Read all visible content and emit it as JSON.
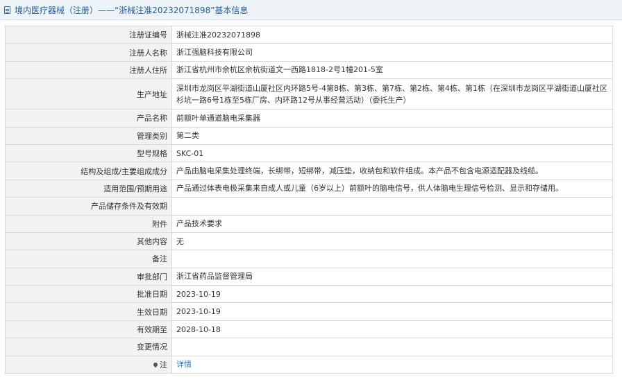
{
  "header": {
    "title": "境内医疗器械（注册）——“浙械注准20232071898”基本信息"
  },
  "rows": [
    {
      "label": "注册证编号",
      "value": "浙械注准20232071898"
    },
    {
      "label": "注册人名称",
      "value": "浙江强脑科技有限公司"
    },
    {
      "label": "注册人住所",
      "value": "浙江省杭州市余杭区余杭街道文一西路1818-2号1幢201-5室"
    },
    {
      "label": "生产地址",
      "value": "深圳市龙岗区平湖街道山厦社区内环路5号-4第8栋、第3栋、第7栋、第2栋、第4栋、第1栋（在深圳市龙岗区平湖街道山厦社区杉坑一路6号1栋至5栋厂房、内环路12号从事经营活动）（委托生产）"
    },
    {
      "label": "产品名称",
      "value": "前额叶单通道脑电采集器"
    },
    {
      "label": "管理类别",
      "value": "第二类"
    },
    {
      "label": "型号规格",
      "value": "SKC-01"
    },
    {
      "label": "结构及组成/主要组成成分",
      "value": "产品由脑电采集处理终端，长绑带，短绑带，减压垫，收纳包和软件组成。本产品不包含电源适配器及线缆。"
    },
    {
      "label": "适用范围/预期用途",
      "value": "产品通过体表电极采集来自成人或儿童（6岁以上）前额叶的脑电信号，供人体脑电生理信号检测、显示和存储用。"
    },
    {
      "label": "产品储存条件及有效期",
      "value": ""
    },
    {
      "label": "附件",
      "value": "产品技术要求"
    },
    {
      "label": "其他内容",
      "value": "无"
    },
    {
      "label": "备注",
      "value": ""
    },
    {
      "label": "审批部门",
      "value": "浙江省药品监督管理局"
    },
    {
      "label": "批准日期",
      "value": "2023-10-19"
    },
    {
      "label": "生效日期",
      "value": "2023-10-19"
    },
    {
      "label": "有效期至",
      "value": "2028-10-18"
    },
    {
      "label": "变更情况",
      "value": ""
    }
  ],
  "note": {
    "label": "注",
    "link": "详情",
    "icon": "pin-icon"
  },
  "colors": {
    "link": "#1f6fb8",
    "title": "#1f5c99",
    "label_bg": "#f2f2f2",
    "border": "#d9d9d9"
  }
}
